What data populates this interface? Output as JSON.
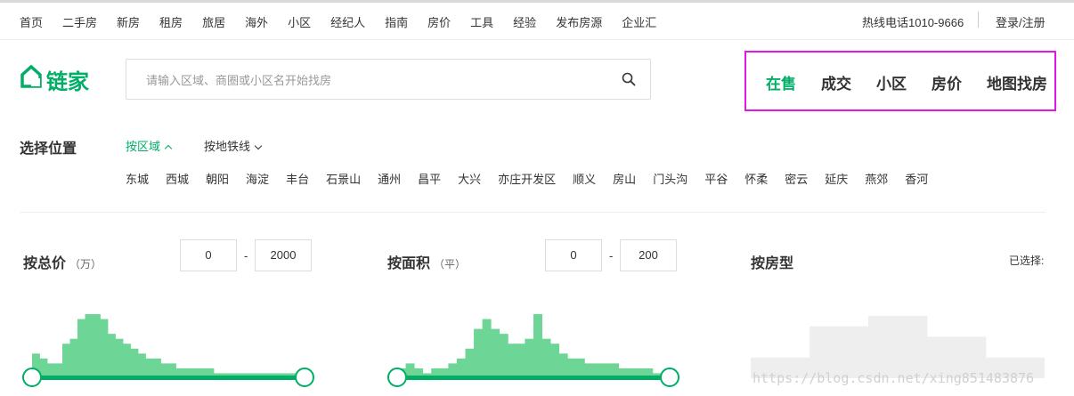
{
  "top_nav": {
    "links": [
      "首页",
      "二手房",
      "新房",
      "租房",
      "旅居",
      "海外",
      "小区",
      "经纪人",
      "指南",
      "房价",
      "工具",
      "经验",
      "发布房源",
      "企业汇"
    ],
    "hotline": "热线电话1010-9666",
    "login": "登录/注册"
  },
  "brand": {
    "name": "链家",
    "color": "#00ae66"
  },
  "search": {
    "placeholder": "请输入区域、商圈或小区名开始找房",
    "value": ""
  },
  "main_nav": {
    "items": [
      "在售",
      "成交",
      "小区",
      "房价",
      "地图找房"
    ],
    "active": "在售",
    "highlight_color": "#e017e5"
  },
  "location": {
    "title": "选择位置",
    "tabs": [
      {
        "label": "按区域",
        "active": true
      },
      {
        "label": "按地铁线",
        "active": false
      }
    ],
    "districts": [
      "东城",
      "西城",
      "朝阳",
      "海淀",
      "丰台",
      "石景山",
      "通州",
      "昌平",
      "大兴",
      "亦庄开发区",
      "顺义",
      "房山",
      "门头沟",
      "平谷",
      "怀柔",
      "密云",
      "延庆",
      "燕郊",
      "香河"
    ]
  },
  "filters": {
    "price": {
      "label": "按总价",
      "unit": "（万）",
      "min": "0",
      "max": "2000",
      "dash": "-"
    },
    "area": {
      "label": "按面积",
      "unit": "（平）",
      "min": "0",
      "max": "200",
      "dash": "-"
    },
    "layout": {
      "label": "按房型"
    },
    "selected_label": "已选择:"
  },
  "chart_data": [
    {
      "type": "bar",
      "title": "",
      "values": [
        5,
        4,
        3,
        3,
        7,
        8,
        12,
        13,
        13,
        12,
        9,
        8,
        7,
        6,
        5,
        4,
        4,
        3,
        3,
        2,
        2,
        2,
        2,
        2,
        1,
        1,
        1,
        1,
        1,
        1,
        1,
        1,
        1,
        1,
        1,
        1
      ],
      "color": "#6dd596"
    },
    {
      "type": "bar",
      "title": "",
      "values": [
        2,
        3,
        2,
        1,
        2,
        2,
        3,
        4,
        6,
        10,
        12,
        10,
        9,
        7,
        7,
        8,
        13,
        8,
        7,
        5,
        4,
        4,
        3,
        3,
        3,
        3,
        2,
        2,
        2,
        2,
        1,
        1
      ],
      "color": "#6dd596"
    },
    {
      "type": "bar",
      "title": "",
      "values": [
        2,
        5,
        6,
        4,
        2
      ],
      "color": "#eeeeee"
    }
  ],
  "watermark": "https://blog.csdn.net/xing851483876"
}
